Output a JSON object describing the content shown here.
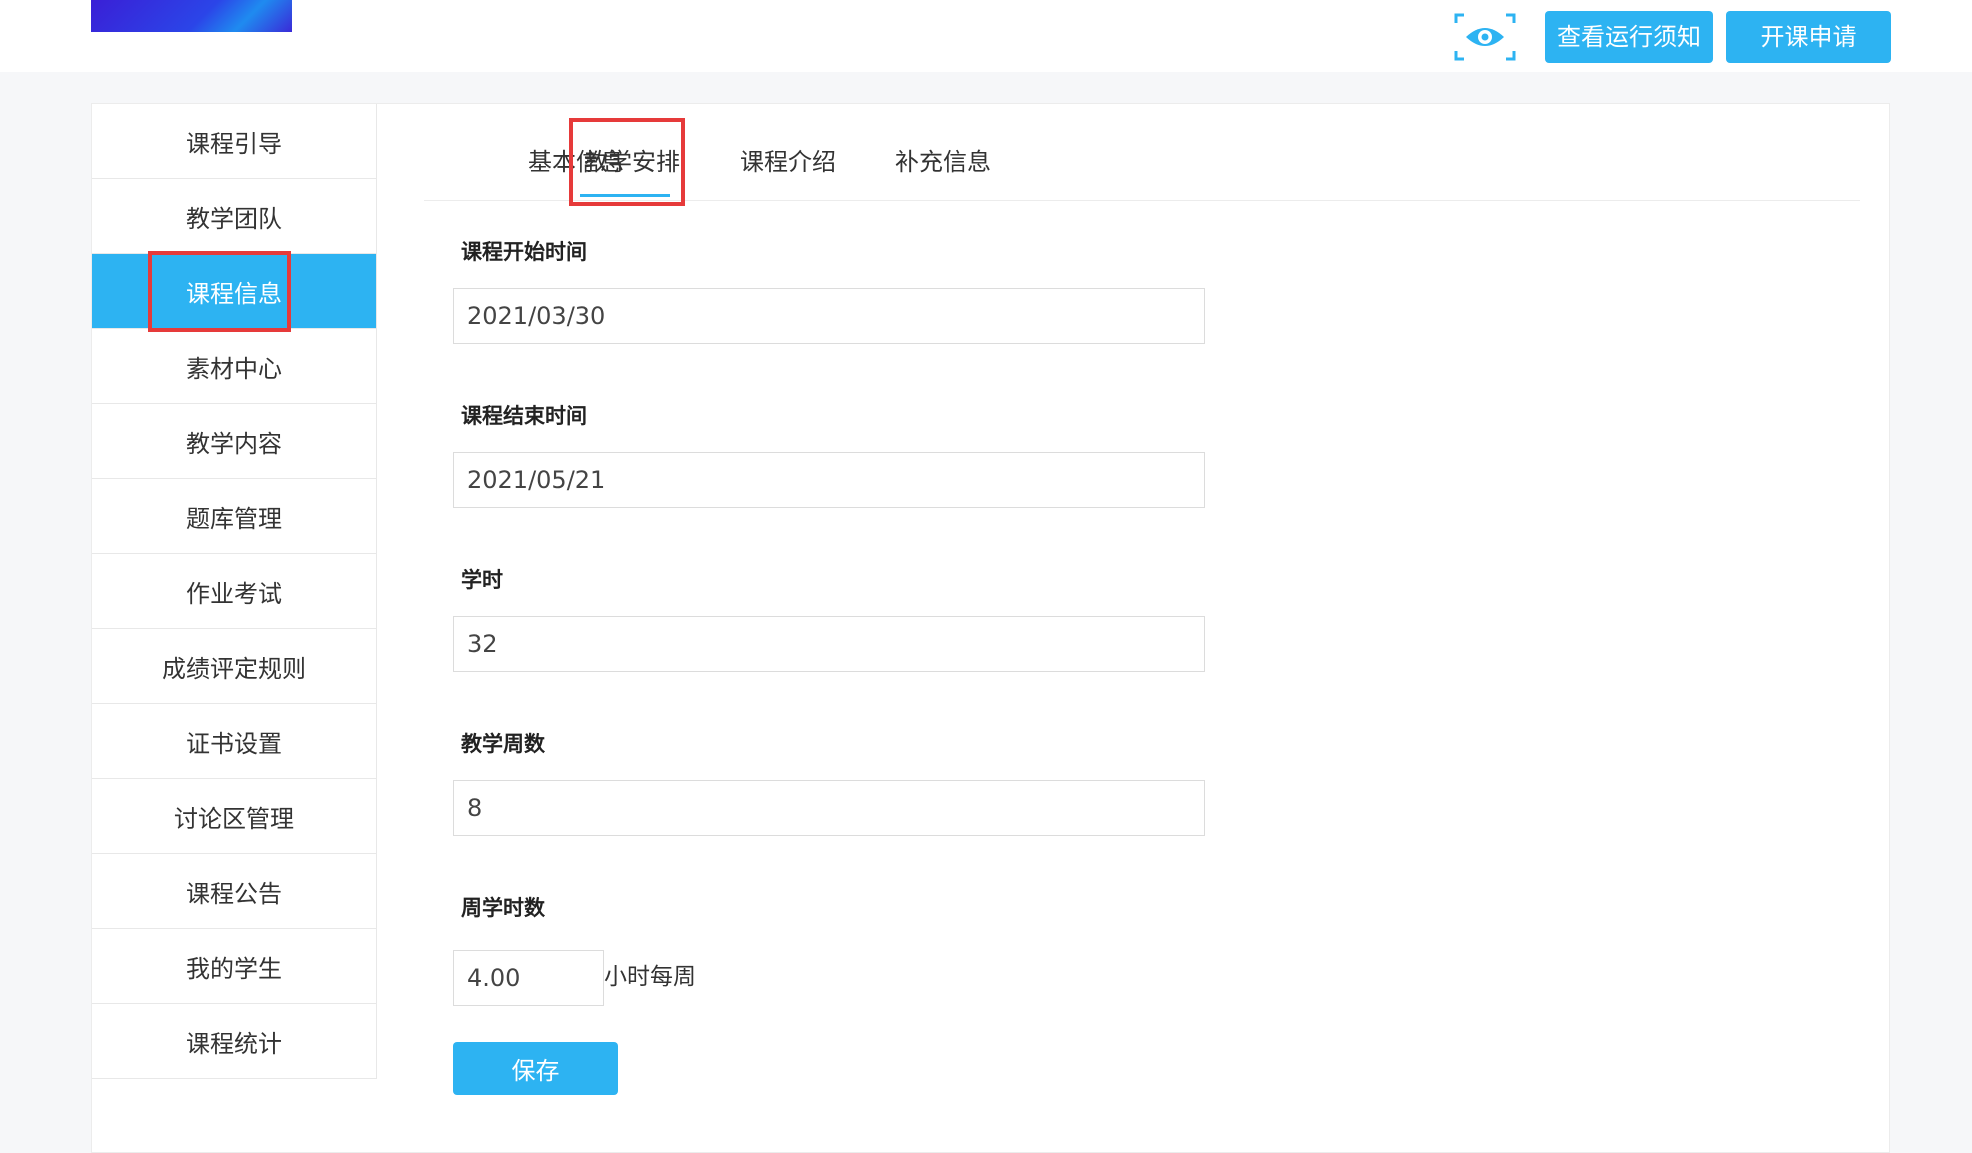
{
  "header": {
    "eye_icon": "eye-icon",
    "notice_button": "查看运行须知",
    "apply_button": "开课申请"
  },
  "sidebar": {
    "items": [
      {
        "label": "课程引导"
      },
      {
        "label": "教学团队"
      },
      {
        "label": "课程信息",
        "active": true
      },
      {
        "label": "素材中心"
      },
      {
        "label": "教学内容"
      },
      {
        "label": "题库管理"
      },
      {
        "label": "作业考试"
      },
      {
        "label": "成绩评定规则"
      },
      {
        "label": "证书设置"
      },
      {
        "label": "讨论区管理"
      },
      {
        "label": "课程公告"
      },
      {
        "label": "我的学生"
      },
      {
        "label": "课程统计"
      }
    ]
  },
  "tabs": [
    {
      "label": "基本信息"
    },
    {
      "label": "教学安排",
      "active": true
    },
    {
      "label": "课程介绍"
    },
    {
      "label": "补充信息"
    }
  ],
  "form": {
    "start_label": "课程开始时间",
    "start_value": "2021/03/30",
    "end_label": "课程结束时间",
    "end_value": "2021/05/21",
    "hours_label": "学时",
    "hours_value": "32",
    "weeks_label": "教学周数",
    "weeks_value": "8",
    "weekly_label": "周学时数",
    "weekly_value": "4.00",
    "weekly_unit": "小时每周",
    "save_label": "保存"
  },
  "colors": {
    "accent": "#2db3f2",
    "highlight": "#e63a3a"
  }
}
